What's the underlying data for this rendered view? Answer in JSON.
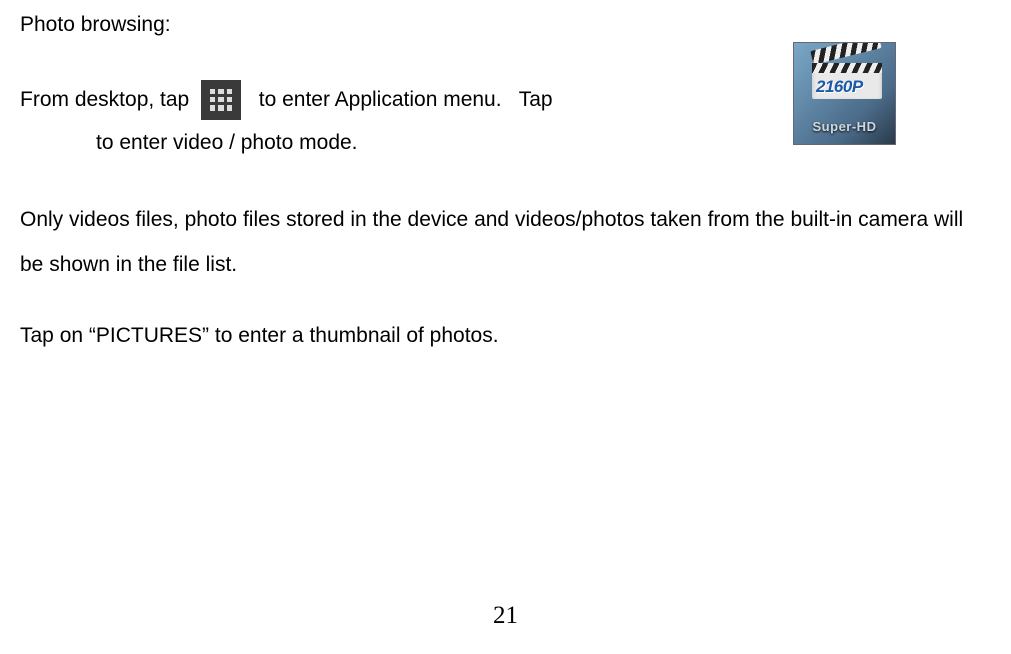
{
  "heading": "Photo browsing:",
  "line1": {
    "seg1": "From desktop, tap ",
    "seg2": "  to enter Application menu.   Tap"
  },
  "line2": "to enter video / photo mode.",
  "para1": "Only videos files, photo files stored in the device and videos/photos taken from the built-in camera will be shown in the file list.",
  "para2": "Tap on “PICTURES” to enter a thumbnail of photos.",
  "float_icon": {
    "badge": "2160P",
    "label": "Super-HD"
  },
  "page_number": "21"
}
